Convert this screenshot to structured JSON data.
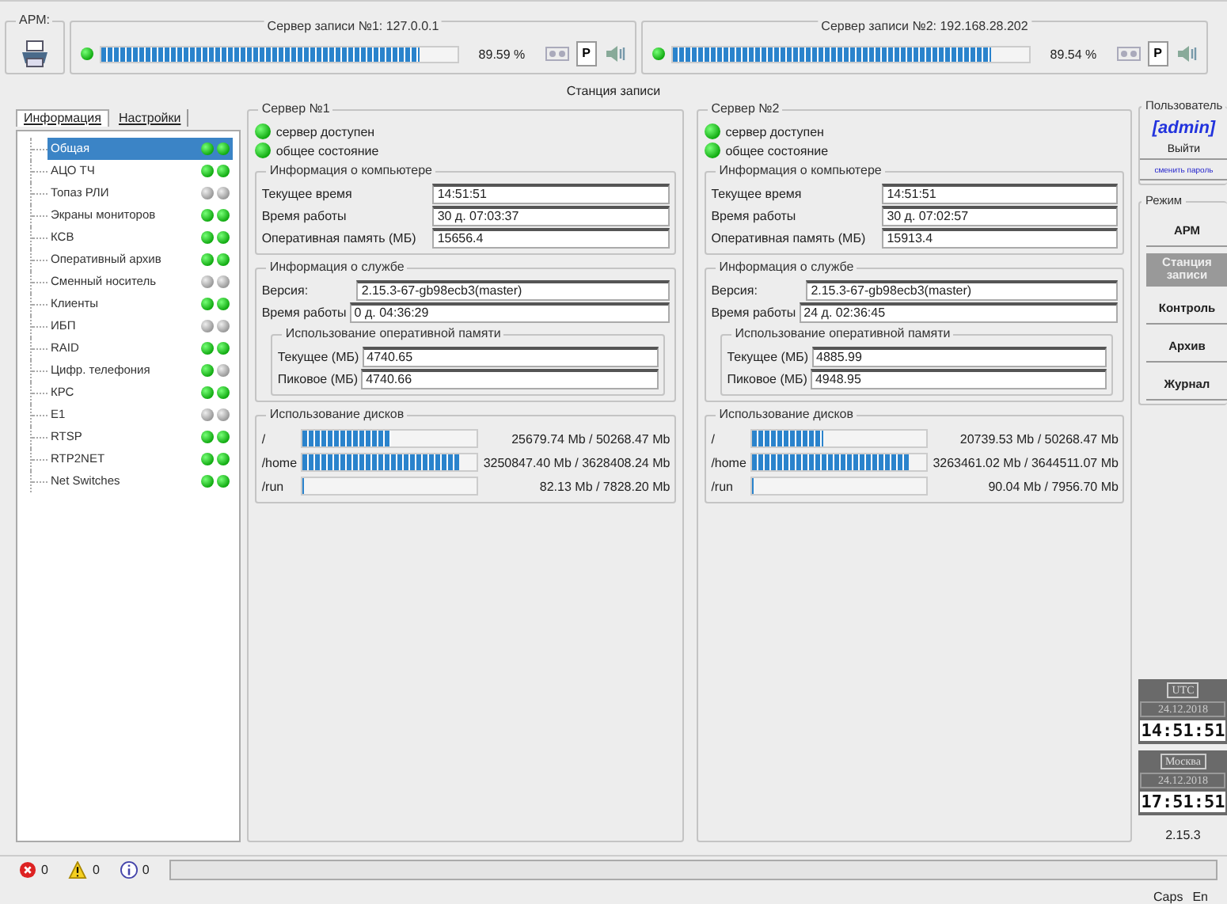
{
  "arm": {
    "label": "АРМ:"
  },
  "record_servers": [
    {
      "title": "Сервер записи №1: 127.0.0.1",
      "online": true,
      "level": 0.8959,
      "reading": "89.59 %",
      "p_label": "P"
    },
    {
      "title": "Сервер записи №2: 192.168.28.202",
      "online": true,
      "level": 0.8954,
      "reading": "89.54 %",
      "p_label": "P"
    }
  ],
  "station_title": "Станция записи",
  "tabs": [
    {
      "label": "Информация",
      "selected": true
    },
    {
      "label": "Настройки",
      "selected": false
    }
  ],
  "tree": [
    {
      "label": "Общая",
      "selected": true,
      "leds": [
        true,
        true
      ]
    },
    {
      "label": "АЦО ТЧ",
      "selected": false,
      "leds": [
        true,
        true
      ]
    },
    {
      "label": "Топаз РЛИ",
      "selected": false,
      "leds": [
        false,
        false
      ]
    },
    {
      "label": "Экраны мониторов",
      "selected": false,
      "leds": [
        true,
        true
      ]
    },
    {
      "label": "КСВ",
      "selected": false,
      "leds": [
        true,
        true
      ]
    },
    {
      "label": "Оперативный архив",
      "selected": false,
      "leds": [
        true,
        true
      ]
    },
    {
      "label": "Сменный носитель",
      "selected": false,
      "leds": [
        false,
        false
      ]
    },
    {
      "label": "Клиенты",
      "selected": false,
      "leds": [
        true,
        true
      ]
    },
    {
      "label": "ИБП",
      "selected": false,
      "leds": [
        false,
        false
      ]
    },
    {
      "label": "RAID",
      "selected": false,
      "leds": [
        true,
        true
      ]
    },
    {
      "label": "Цифр. телефония",
      "selected": false,
      "leds": [
        true,
        false
      ]
    },
    {
      "label": "КРС",
      "selected": false,
      "leds": [
        true,
        true
      ]
    },
    {
      "label": "E1",
      "selected": false,
      "leds": [
        false,
        false
      ]
    },
    {
      "label": "RTSP",
      "selected": false,
      "leds": [
        true,
        true
      ]
    },
    {
      "label": "RTP2NET",
      "selected": false,
      "leds": [
        true,
        true
      ]
    },
    {
      "label": "Net Switches",
      "selected": false,
      "leds": [
        true,
        true
      ]
    }
  ],
  "servers": [
    {
      "title": "Сервер №1",
      "indicators": [
        {
          "label": "сервер доступен",
          "on": true
        },
        {
          "label": "общее состояние",
          "on": true
        }
      ],
      "computer": {
        "title": "Информация о компьютере",
        "rows": [
          {
            "label": "Текущее время",
            "value": "14:51:51"
          },
          {
            "label": "Время работы",
            "value": "30 д. 07:03:37"
          },
          {
            "label": "Оперативная память (МБ)",
            "value": "15656.4"
          }
        ]
      },
      "service": {
        "title": "Информация о службе",
        "rows": [
          {
            "label": "Версия:",
            "value": "2.15.3-67-gb98ecb3(master)"
          },
          {
            "label": "Время работы",
            "value": "0 д. 04:36:29"
          }
        ],
        "memory": {
          "title": "Использование оперативной памяти",
          "rows": [
            {
              "label": "Текущее (МБ)",
              "value": "4740.65"
            },
            {
              "label": "Пиковое (МБ)",
              "value": "4740.66"
            }
          ]
        }
      },
      "disks": {
        "title": "Использование дисков",
        "rows": [
          {
            "path": "/",
            "level": 0.51,
            "reading": "25679.74 Mb / 50268.47 Mb"
          },
          {
            "path": "/home",
            "level": 0.9,
            "reading": "3250847.40 Mb / 3628408.24 Mb"
          },
          {
            "path": "/run",
            "level": 0.01,
            "reading": "82.13 Mb / 7828.20 Mb"
          }
        ]
      }
    },
    {
      "title": "Сервер №2",
      "indicators": [
        {
          "label": "сервер доступен",
          "on": true
        },
        {
          "label": "общее состояние",
          "on": true
        }
      ],
      "computer": {
        "title": "Информация о компьютере",
        "rows": [
          {
            "label": "Текущее время",
            "value": "14:51:51"
          },
          {
            "label": "Время работы",
            "value": "30 д. 07:02:57"
          },
          {
            "label": "Оперативная память (МБ)",
            "value": "15913.4"
          }
        ]
      },
      "service": {
        "title": "Информация о службе",
        "rows": [
          {
            "label": "Версия:",
            "value": "2.15.3-67-gb98ecb3(master)"
          },
          {
            "label": "Время работы",
            "value": "24 д. 02:36:45"
          }
        ],
        "memory": {
          "title": "Использование оперативной памяти",
          "rows": [
            {
              "label": "Текущее (МБ)",
              "value": "4885.99"
            },
            {
              "label": "Пиковое (МБ)",
              "value": "4948.95"
            }
          ]
        }
      },
      "disks": {
        "title": "Использование дисков",
        "rows": [
          {
            "path": "/",
            "level": 0.41,
            "reading": "20739.53 Mb / 50268.47 Mb"
          },
          {
            "path": "/home",
            "level": 0.9,
            "reading": "3263461.02 Mb / 3644511.07 Mb"
          },
          {
            "path": "/run",
            "level": 0.01,
            "reading": "90.04 Mb / 7956.70 Mb"
          }
        ]
      }
    }
  ],
  "user": {
    "title": "Пользователь",
    "name": "[admin]",
    "logout": "Выйти",
    "change_password": "сменить пароль"
  },
  "mode": {
    "title": "Режим",
    "buttons": [
      {
        "label": "АРМ",
        "selected": false
      },
      {
        "label": "Станция записи",
        "selected": true
      },
      {
        "label": "Контроль",
        "selected": false
      },
      {
        "label": "Архив",
        "selected": false
      },
      {
        "label": "Журнал",
        "selected": false
      }
    ]
  },
  "clocks": [
    {
      "title": "UTC",
      "date": "24.12.2018",
      "time": "14:51:51"
    },
    {
      "title": "Москва",
      "date": "24.12.2018",
      "time": "17:51:51"
    }
  ],
  "version": "2.15.3",
  "status_bar": {
    "errors": "0",
    "warnings": "0",
    "info": "0"
  },
  "indicators_bar": {
    "caps": "Caps",
    "lang": "En"
  }
}
